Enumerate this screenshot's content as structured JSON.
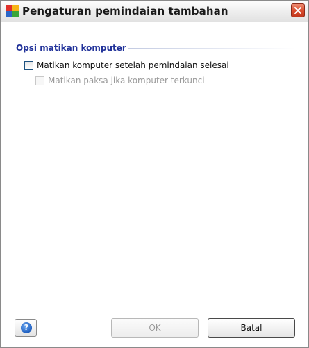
{
  "window": {
    "title": "Pengaturan pemindaian tambahan",
    "icon": "avg-app-icon",
    "close_icon": "close-icon"
  },
  "section": {
    "title": "Opsi matikan komputer"
  },
  "options": [
    {
      "label": "Matikan komputer setelah pemindaian selesai",
      "checked": false,
      "enabled": true
    },
    {
      "label": "Matikan paksa jika komputer terkunci",
      "checked": false,
      "enabled": false
    }
  ],
  "buttons": {
    "help_icon": "help-icon",
    "help_glyph": "?",
    "ok_label": "OK",
    "cancel_label": "Batal"
  },
  "colors": {
    "section_title": "#22339a",
    "close_button": "#d94a2c",
    "disabled_text": "#9a9a9a"
  }
}
